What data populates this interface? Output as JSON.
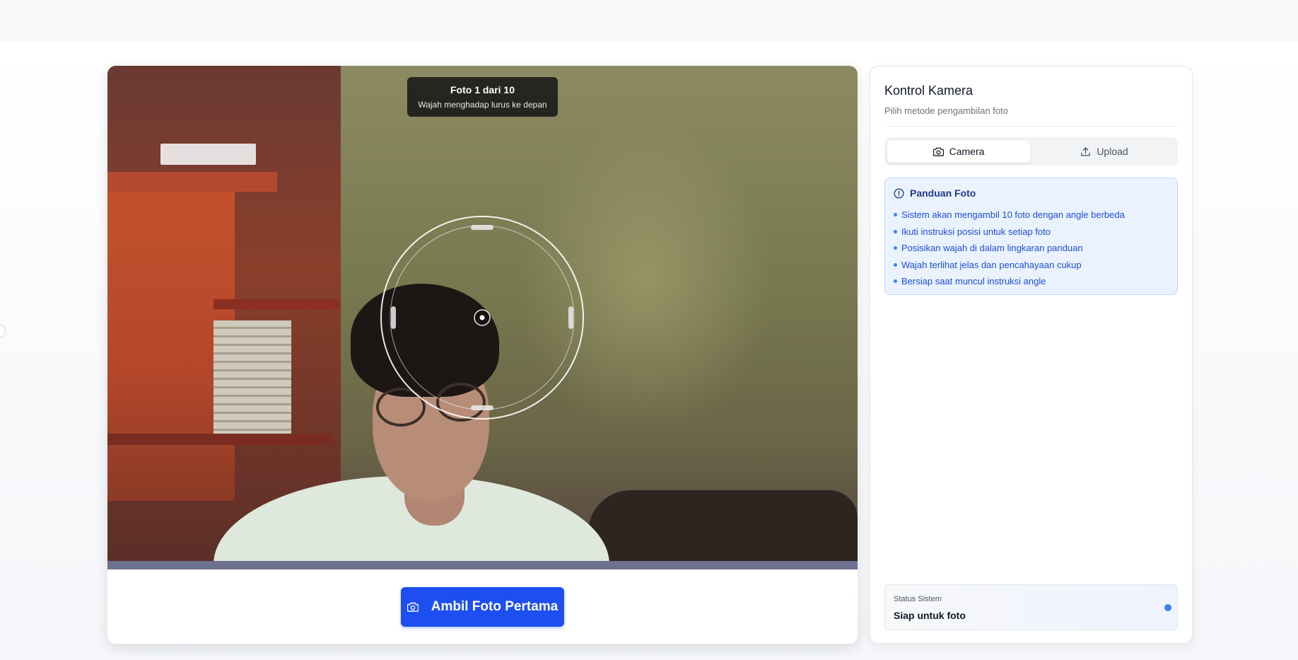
{
  "camera": {
    "badge_title": "Foto 1 dari 10",
    "badge_instruction": "Wajah menghadap lurus ke depan",
    "capture_label": "Ambil Foto Pertama",
    "capture_icon": "camera-icon"
  },
  "control": {
    "title": "Kontrol Kamera",
    "subtitle": "Pilih metode pengambilan foto",
    "tabs": [
      {
        "label": "Camera",
        "icon": "camera-icon",
        "active": true
      },
      {
        "label": "Upload",
        "icon": "upload-icon",
        "active": false
      }
    ],
    "guide": {
      "title": "Panduan Foto",
      "icon": "info-icon",
      "items": [
        "Sistem akan mengambil 10 foto dengan angle berbeda",
        "Ikuti instruksi posisi untuk setiap foto",
        "Posisikan wajah di dalam lingkaran panduan",
        "Wajah terlihat jelas dan pencahayaan cukup",
        "Bersiap saat muncul instruksi angle"
      ]
    },
    "status": {
      "label": "Status Sistem",
      "value": "Siap untuk foto",
      "indicator_color": "#3b82f6"
    }
  },
  "colors": {
    "primary": "#1d4ff0",
    "guide_bg": "#eaf2fe",
    "guide_text": "#1d4ed8"
  }
}
